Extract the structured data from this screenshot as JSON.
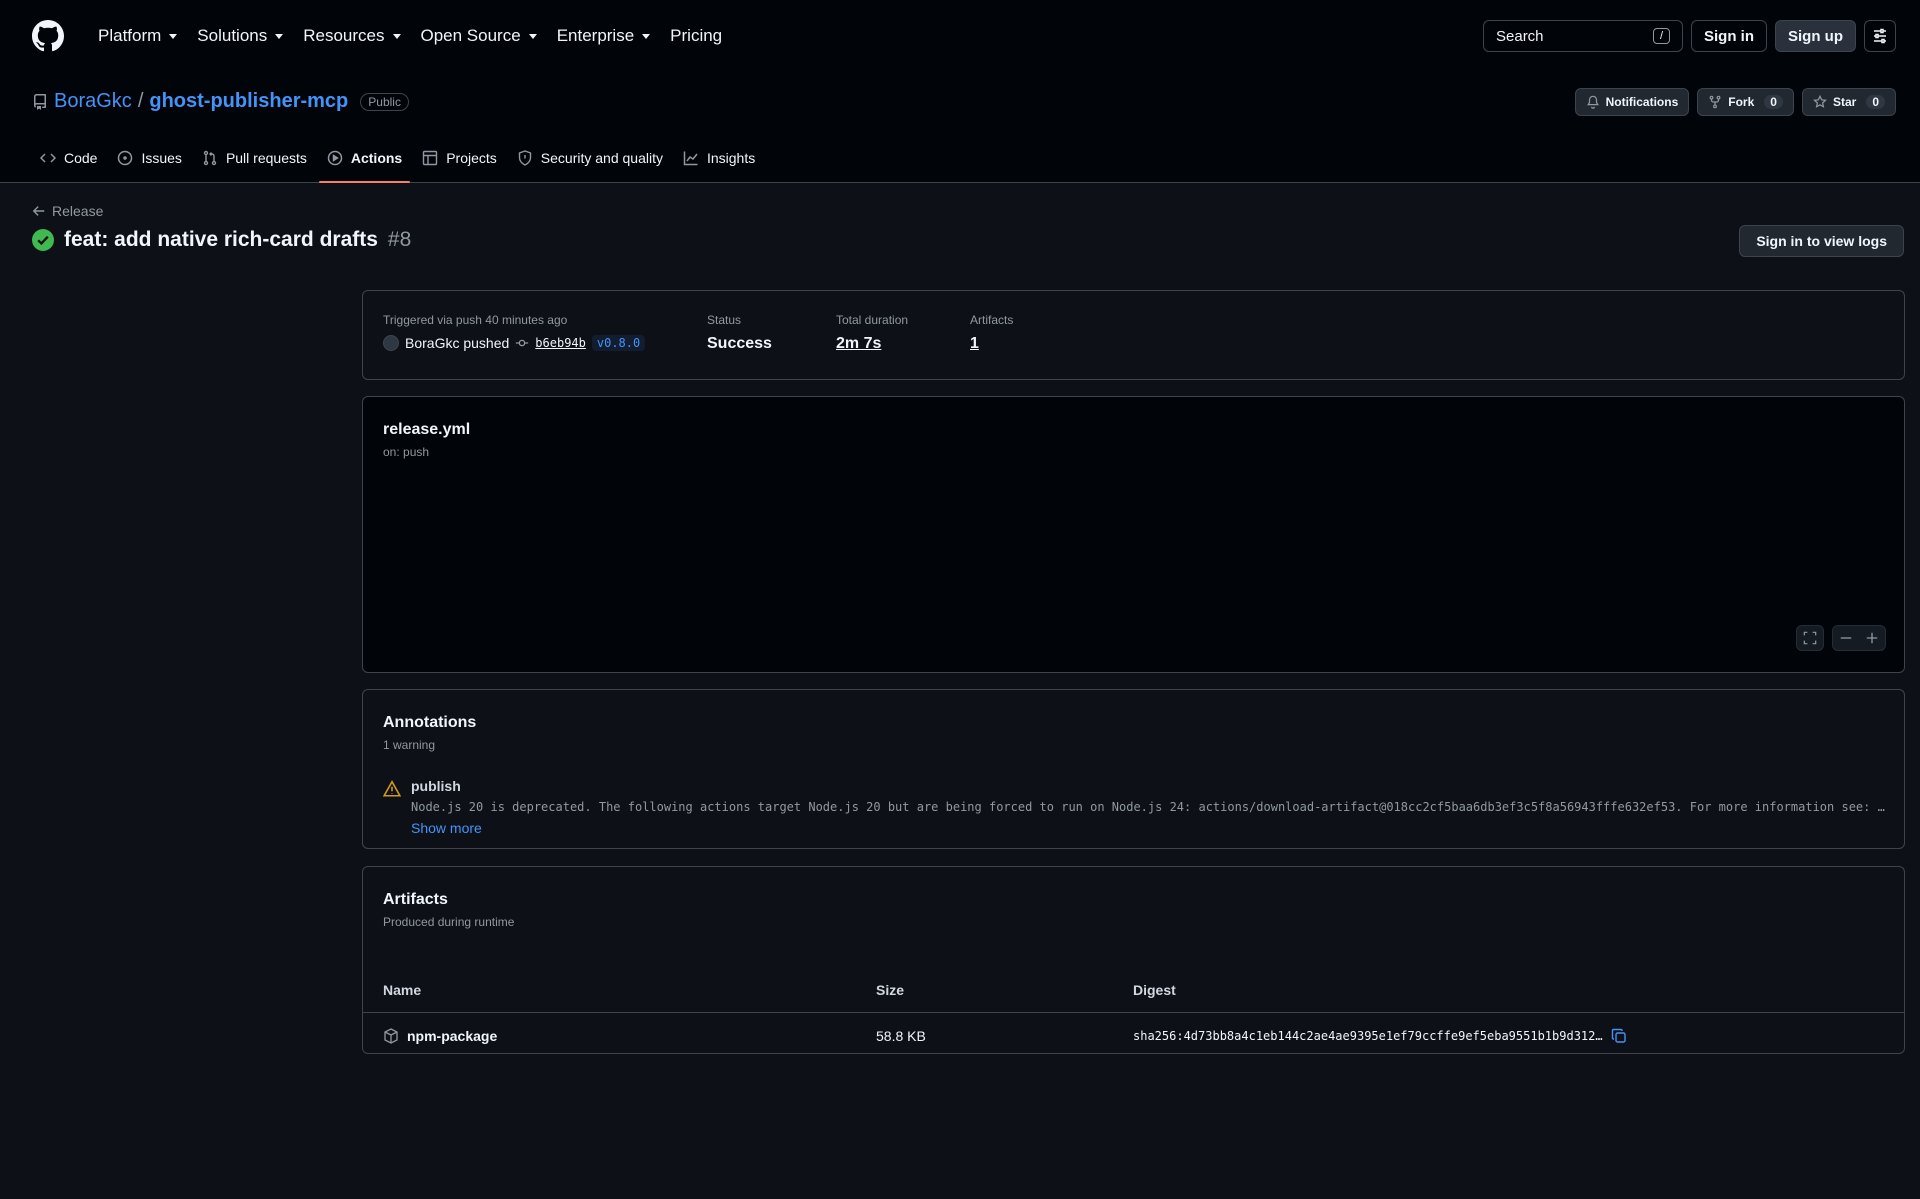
{
  "header": {
    "nav": [
      "Platform",
      "Solutions",
      "Resources",
      "Open Source",
      "Enterprise",
      "Pricing"
    ],
    "search_label": "Search",
    "search_shortcut": "/",
    "sign_in": "Sign in",
    "sign_up": "Sign up"
  },
  "repo": {
    "owner": "BoraGkc",
    "separator": "/",
    "name": "ghost-publisher-mcp",
    "visibility": "Public",
    "notifications": "Notifications",
    "fork_label": "Fork",
    "fork_count": "0",
    "star_label": "Star",
    "star_count": "0",
    "tabs": [
      {
        "label": "Code",
        "active": false
      },
      {
        "label": "Issues",
        "active": false
      },
      {
        "label": "Pull requests",
        "active": false
      },
      {
        "label": "Actions",
        "active": true
      },
      {
        "label": "Projects",
        "active": false
      },
      {
        "label": "Security and quality",
        "active": false
      },
      {
        "label": "Insights",
        "active": false
      }
    ]
  },
  "run": {
    "back_label": "Release",
    "title": "feat: add native rich-card drafts",
    "number": "#8",
    "logs_button": "Sign in to view logs",
    "status_color": "#3fb950"
  },
  "summary": {
    "triggered": "Triggered via push 40 minutes ago",
    "actor": "BoraGkc pushed",
    "sha": "b6eb94b",
    "tag": "v0.8.0",
    "status_label": "Status",
    "status_value": "Success",
    "duration_label": "Total duration",
    "duration_value": "2m 7s",
    "artifacts_label": "Artifacts",
    "artifacts_value": "1"
  },
  "workflow": {
    "file": "release.yml",
    "trigger": "on: push"
  },
  "annotations": {
    "title": "Annotations",
    "count": "1 warning",
    "item_title": "publish",
    "item_message": "Node.js 20 is deprecated. The following actions target Node.js 20 but are being forced to run on Node.js 24: actions/download-artifact@018cc2cf5baa6db3ef3c5f8a56943fffe632ef53. For more information see: https://github.blog/changelog/",
    "show_more": "Show more",
    "warn_color": "#d29922"
  },
  "artifacts": {
    "title": "Artifacts",
    "subtitle": "Produced during runtime",
    "columns": {
      "name": "Name",
      "size": "Size",
      "digest": "Digest"
    },
    "rows": [
      {
        "name": "npm-package",
        "size": "58.8 KB",
        "digest": "sha256:4d73bb8a4c1eb144c2ae4ae9395e1ef79ccffe9ef5eba9551b1b9d312…"
      }
    ]
  }
}
